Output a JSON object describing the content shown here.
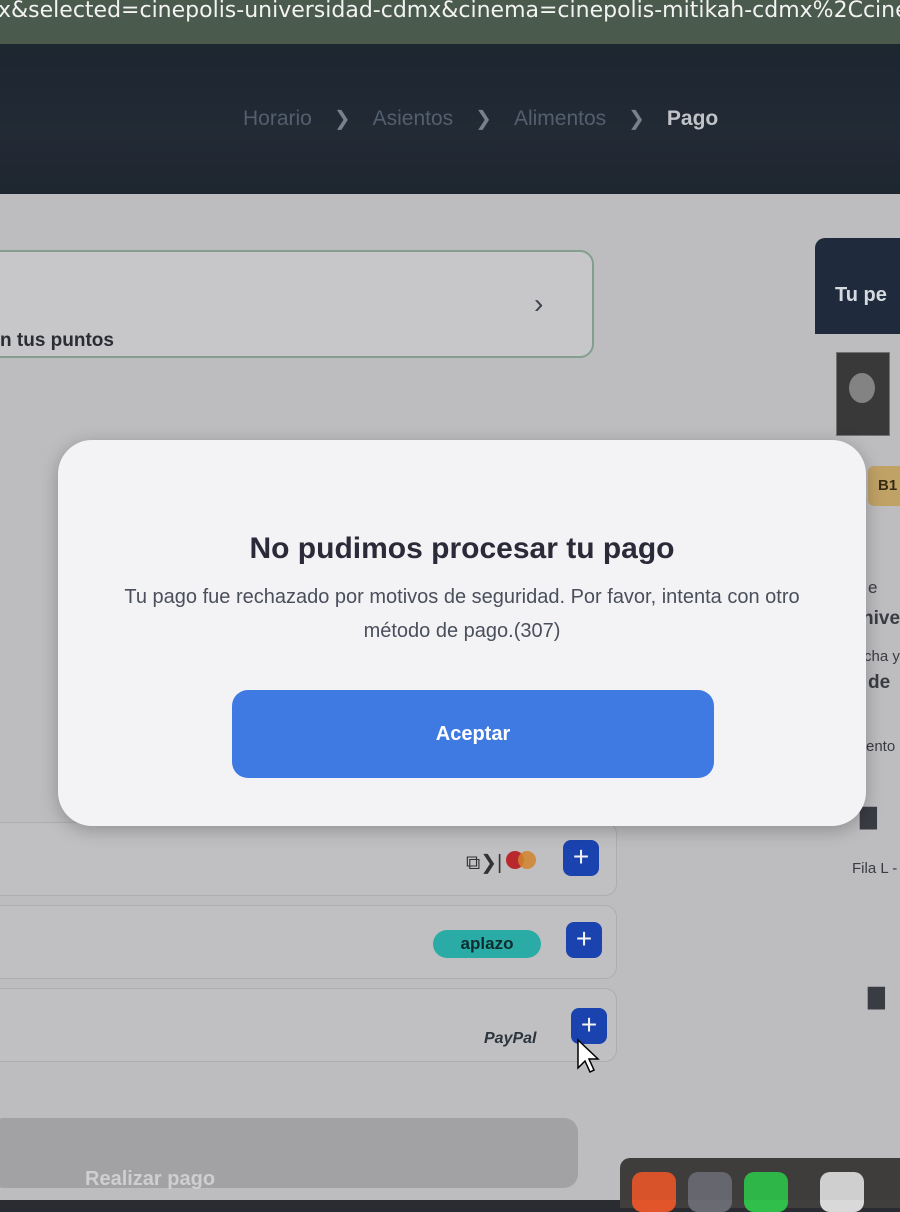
{
  "browser": {
    "url": "x&selected=cinepolis-universidad-cdmx&cinema=cinepolis-mitikah-cdmx%2Ccinepol"
  },
  "header": {
    "steps": [
      "Horario",
      "Asientos",
      "Alimentos",
      "Pago"
    ],
    "active_step": "Pago"
  },
  "page": {
    "points_text": "n tus puntos",
    "side_panel_title": "Tu pe",
    "seat_badge": "B1",
    "side_snippets": [
      "e",
      "nive",
      "cha y",
      "de",
      "ento",
      "Fila L -"
    ],
    "payment_methods": [
      {
        "name": "cards",
        "label": ""
      },
      {
        "name": "aplazo",
        "label": "aplazo"
      },
      {
        "name": "paypal",
        "label": "PayPal"
      }
    ],
    "add_label": "+",
    "pay_button": "Realizar pago"
  },
  "modal": {
    "title": "No pudimos procesar tu pago",
    "body": "Tu pago fue rechazado por motivos de seguridad. Por favor, intenta con otro método de pago.(307)",
    "accept": "Aceptar"
  },
  "colors": {
    "accept_button": "#3f7ae3",
    "plus_button": "#1b45b7",
    "aplazo": "#2bb3ad"
  }
}
